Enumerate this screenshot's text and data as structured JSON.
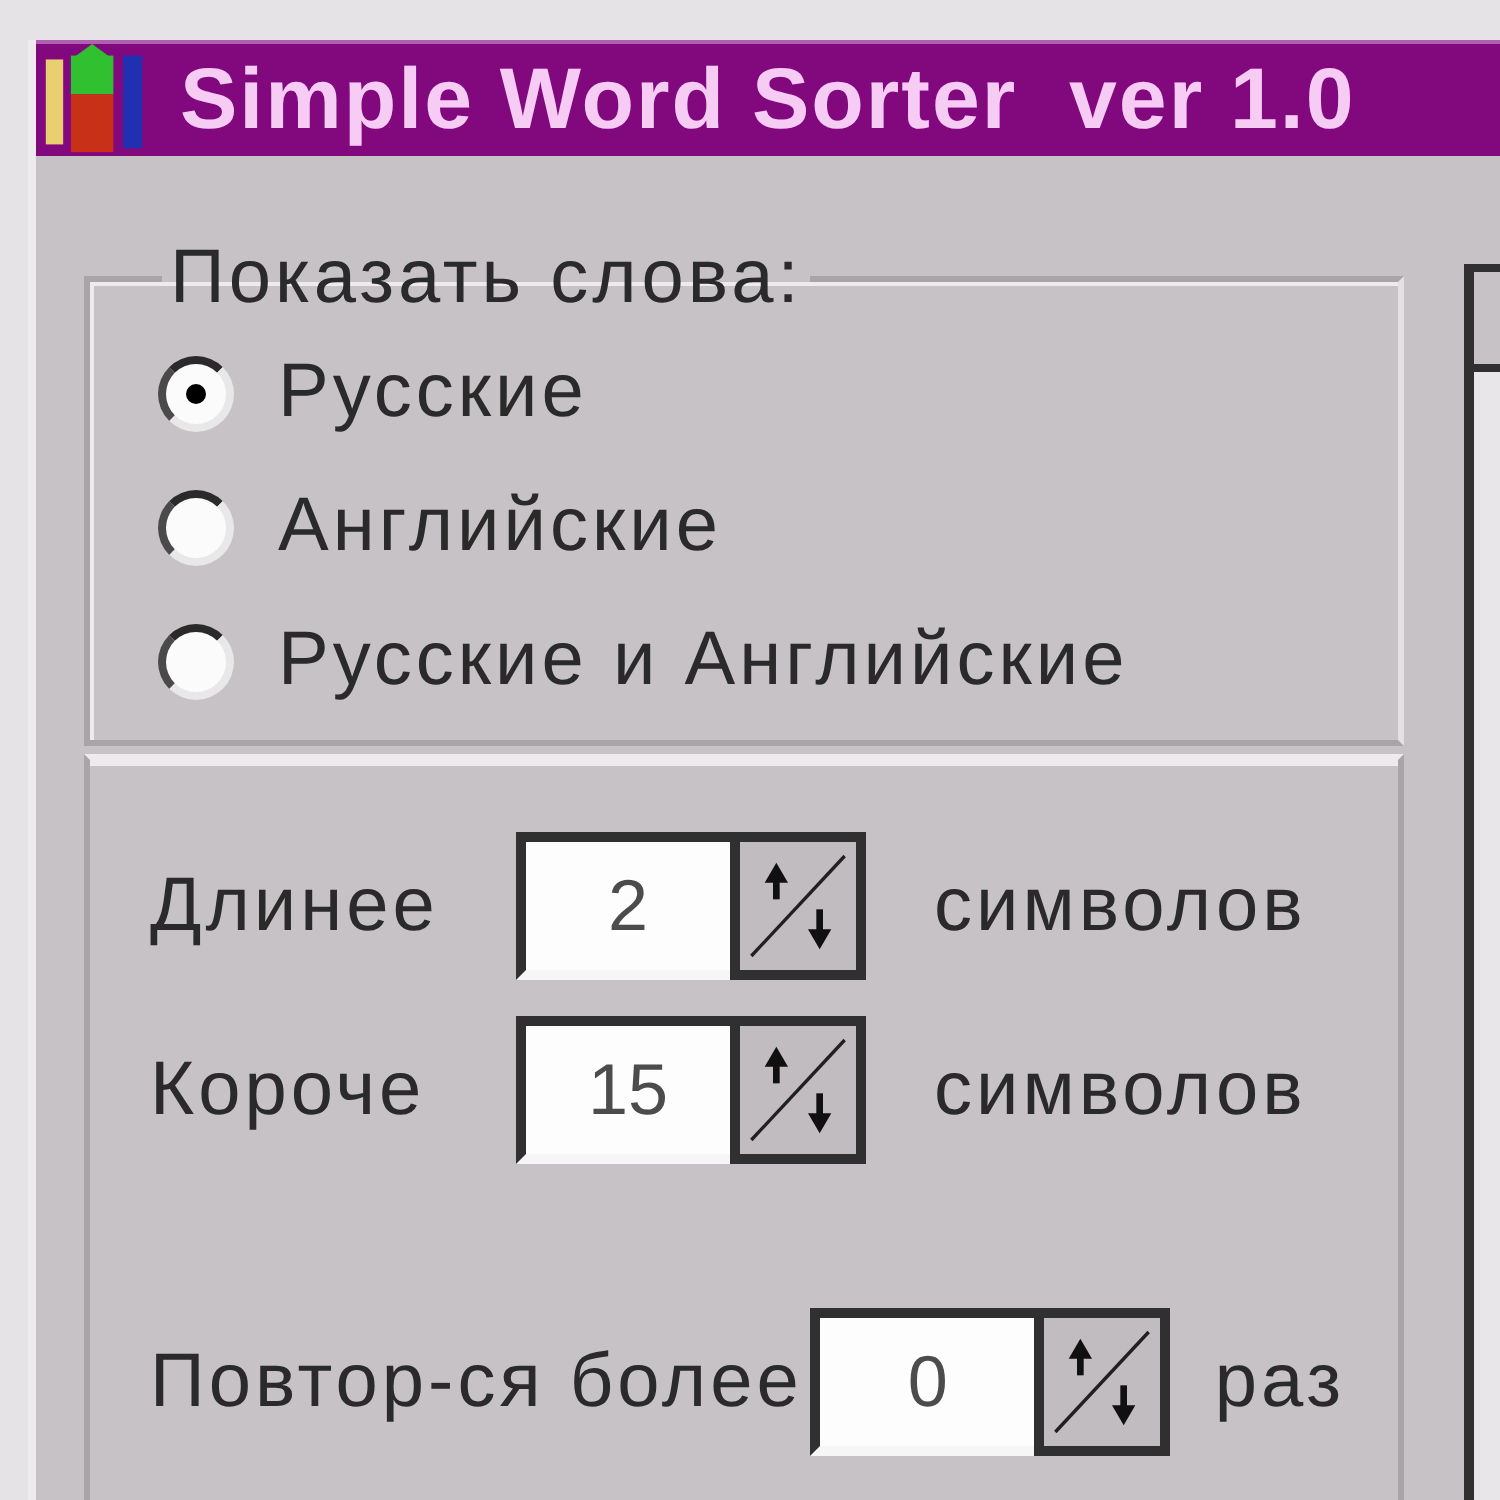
{
  "window": {
    "title": "Simple Word Sorter  ver 1.0"
  },
  "show_words": {
    "label": "Показать слова:",
    "options": [
      {
        "label": "Русские",
        "selected": true
      },
      {
        "label": "Английские",
        "selected": false
      },
      {
        "label": "Русские и Английские",
        "selected": false
      }
    ]
  },
  "length_filters": [
    {
      "label": "Длинее",
      "value": "2",
      "unit": "символов"
    },
    {
      "label": "Короче",
      "value": "15",
      "unit": "символов"
    }
  ],
  "repeat_filter": {
    "label": "Повтор-ся более",
    "value": "0",
    "unit": "раз"
  }
}
